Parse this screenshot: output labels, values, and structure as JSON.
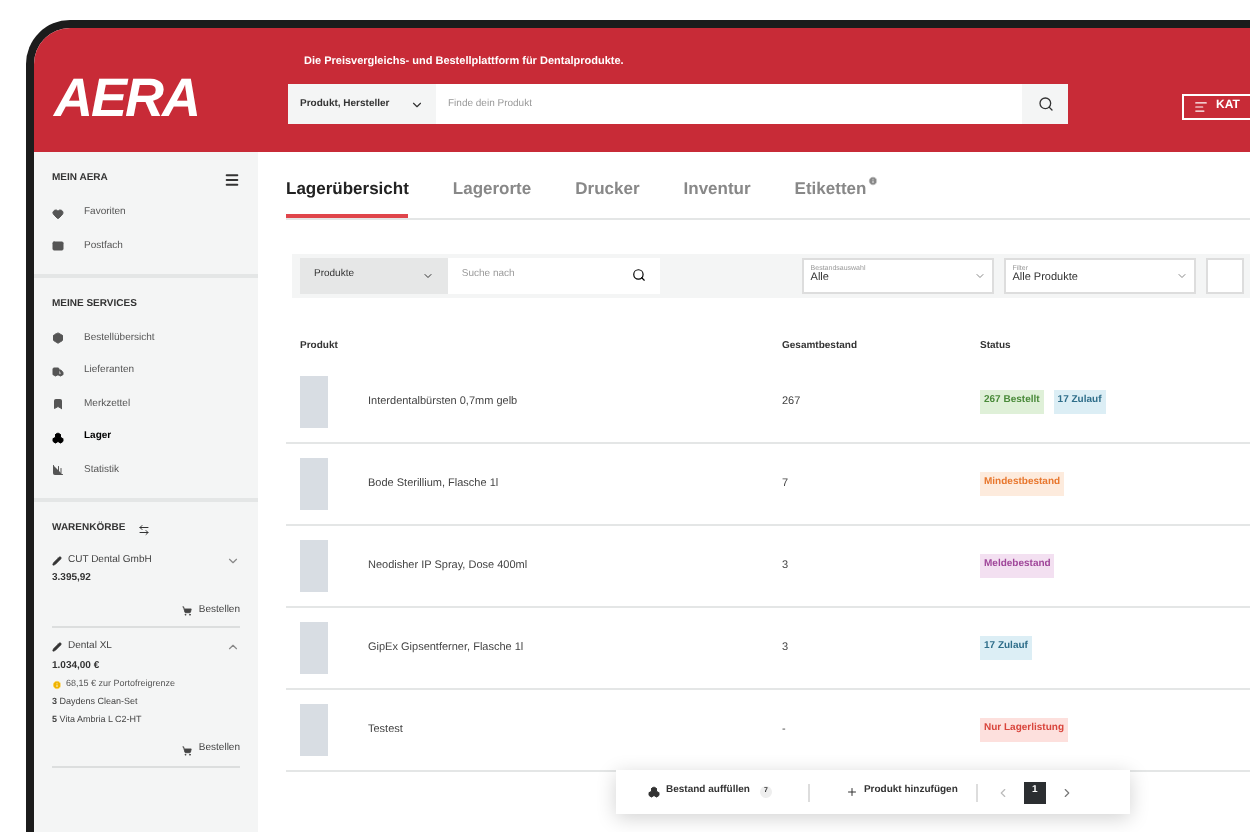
{
  "header": {
    "logo": "AERA",
    "tagline": "Die Preisvergleichs- und Bestellplattform für Dentalprodukte.",
    "search_scope": "Produkt, Hersteller",
    "search_placeholder": "Finde dein Produkt",
    "menu_button": "KAT"
  },
  "sidebar": {
    "sections": [
      {
        "title": "MEIN AERA",
        "kind": "menu",
        "items": [
          {
            "label": "Favoriten",
            "selected": false
          },
          {
            "label": "Postfach",
            "selected": false
          }
        ]
      },
      {
        "title": "MEINE SERVICES",
        "kind": "plain",
        "items": [
          {
            "label": "Bestellübersicht",
            "selected": false
          },
          {
            "label": "Lieferanten",
            "selected": false
          },
          {
            "label": "Merkzettel",
            "selected": false
          },
          {
            "label": "Lager",
            "selected": true
          },
          {
            "label": "Statistik",
            "selected": false
          }
        ]
      }
    ],
    "carts_title": "WARENKÖRBE",
    "carts": [
      {
        "name": "CUT Dental GmbH",
        "total": "3.395,92",
        "expanded": false,
        "order_button": "Bestellen"
      },
      {
        "name": "Dental XL",
        "total": "1.034,00 €",
        "expanded": true,
        "notice": "68,15 € zur Portofreigrenze",
        "lines": [
          {
            "qty": "3",
            "name": "Daydens Clean-Set"
          },
          {
            "qty": "5",
            "name": "Vita Ambria L C2-HT"
          }
        ],
        "order_button": "Bestellen"
      }
    ]
  },
  "tabs": [
    {
      "label": "Lagerübersicht",
      "selected": true,
      "info": false
    },
    {
      "label": "Lagerorte",
      "selected": false,
      "info": false
    },
    {
      "label": "Drucker",
      "selected": false,
      "info": false
    },
    {
      "label": "Inventur",
      "selected": false,
      "info": false
    },
    {
      "label": "Etiketten",
      "selected": false,
      "info": true
    }
  ],
  "filters": {
    "scope": "Produkte",
    "search_placeholder": "Suche nach",
    "dropdowns": [
      {
        "label": "Bestandsauswahl",
        "value": "Alle"
      },
      {
        "label": "Filter",
        "value": "Alle Produkte"
      }
    ]
  },
  "table": {
    "columns": [
      "Produkt",
      "Gesamtbestand",
      "Status"
    ],
    "rows": [
      {
        "name": "Interdentalbürsten 0,7mm gelb",
        "stock": "267",
        "badges": [
          {
            "text": "267 Bestellt",
            "kind": "ordered"
          },
          {
            "text": "17 Zulauf",
            "kind": "incoming"
          }
        ]
      },
      {
        "name": "Bode Sterillium, Flasche 1l",
        "stock": "7",
        "badges": [
          {
            "text": "Mindestbestand",
            "kind": "minimum"
          }
        ]
      },
      {
        "name": "Neodisher IP Spray, Dose 400ml",
        "stock": "3",
        "badges": [
          {
            "text": "Meldebestand",
            "kind": "reorder"
          }
        ]
      },
      {
        "name": "GipEx Gipsentferner, Flasche 1l",
        "stock": "3",
        "badges": [
          {
            "text": "17 Zulauf",
            "kind": "incoming"
          }
        ]
      },
      {
        "name": "Testest",
        "stock": "-",
        "badges": [
          {
            "text": "Nur Lagerlistung",
            "kind": "listing"
          }
        ]
      }
    ]
  },
  "actions": {
    "refill": "Bestand auffüllen",
    "refill_count": "7",
    "add": "Produkt hinzufügen",
    "pages": [
      {
        "label": "1",
        "selected": true
      }
    ]
  }
}
